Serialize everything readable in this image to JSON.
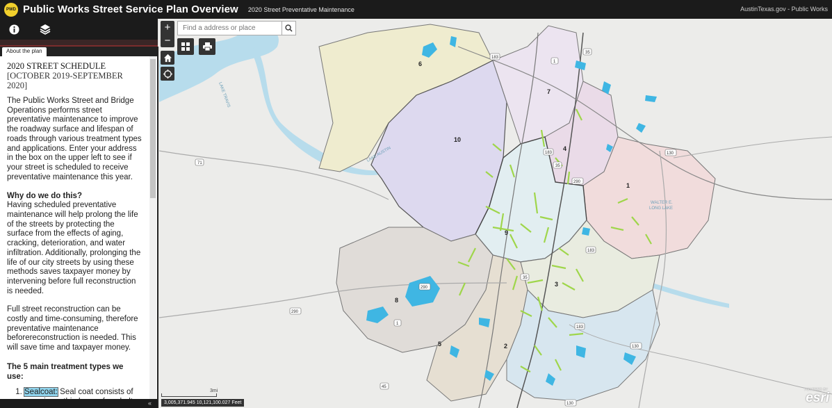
{
  "header": {
    "logo_text": "PWD",
    "title": "Public Works Street Service Plan Overview",
    "subtitle": "2020 Street Preventative Maintenance",
    "right_text": "AustinTexas.gov - Public Works"
  },
  "panel": {
    "tab": "About the plan",
    "heading_line1": "2020 STREET SCHEDULE",
    "heading_line2": "[OCTOBER 2019-SEPTEMBER 2020]",
    "intro": "The Public Works Street and Bridge Operations performs street preventative maintenance to improve the roadway surface and lifespan of roads through various treatment types and applications. Enter your address in the box on the upper left to see if your street is scheduled to receive preventative maintenance this year.",
    "why_heading": "Why do we do this?",
    "why_body": "Having scheduled preventative maintenance will help prolong the life of the streets by protecting the surface from the effects of aging, cracking, deterioration, and water infiltration. Additionally, prolonging the life of our city streets by using these methods saves taxpayer money by intervening before full reconstruction is needed.",
    "full_body": "Full street reconstruction can be costly and time-consuming, therefore preventative maintenance beforereconstruction is needed. This will save time and taxpayer money.",
    "types_heading": "The 5 main treatment types we use:",
    "item1_term": "Sealcoat:",
    "item1_text": " Seal coat consists of spraying a thin layer of asphalt",
    "collapse_glyph": "«"
  },
  "map": {
    "search_placeholder": "Find a address or place",
    "zoom_in": "+",
    "zoom_out": "−",
    "scale_label": "3mi",
    "coordinates": "3,005,371.945 10,121,100.027 Feet",
    "attribution": "esri",
    "attribution_small": "POWERED BY",
    "lake_label_1": "LAKE TRAVIS",
    "lake_label_2": "LAKE AUSTIN",
    "lake_label_3a": "WALTER E.",
    "lake_label_3b": "LONG LAKE",
    "districts": [
      "1",
      "2",
      "3",
      "4",
      "5",
      "6",
      "7",
      "8",
      "9",
      "10"
    ],
    "shields": [
      "183",
      "35",
      "1",
      "71",
      "183",
      "35",
      "290",
      "130",
      "183",
      "290",
      "35",
      "1",
      "290",
      "71",
      "183",
      "130",
      "45",
      "130"
    ]
  },
  "colors": {
    "bar": "#1b1b1b",
    "water": "#b7dcec",
    "park_blue": "#3fb6e3",
    "street_green": "#9fd64b"
  }
}
